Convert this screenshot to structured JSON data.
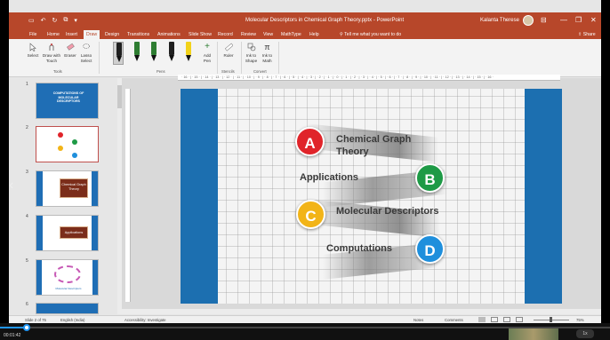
{
  "window": {
    "title": "Molecular Descriptors in Chemical Graph Theory.pptx - PowerPoint",
    "user": "Kalanta Therese",
    "qat": [
      "▭",
      "↶",
      "↻",
      "⧉",
      "▾"
    ],
    "controls": [
      "⊟",
      "—",
      "❐",
      "✕"
    ]
  },
  "tabs": {
    "items": [
      "File",
      "Home",
      "Insert",
      "Draw",
      "Design",
      "Transitions",
      "Animations",
      "Slide Show",
      "Record",
      "Review",
      "View",
      "MathType",
      "Help"
    ],
    "active": "Draw",
    "tell_me": "Tell me what you want to do",
    "share": "Share"
  },
  "ribbon": {
    "tools": [
      "Select",
      "Draw with Touch",
      "Eraser",
      "Lasso Select"
    ],
    "tools_group": "Tools",
    "pens_group": "Pens",
    "pens": [
      {
        "color": "#1f1f1f",
        "selected": true
      },
      {
        "color": "#2e7d32",
        "selected": false
      },
      {
        "color": "#2e7d32",
        "selected": false
      },
      {
        "color": "#1f1f1f",
        "selected": false
      },
      {
        "color": "#f2d21a",
        "selected": false
      }
    ],
    "add_pen": "Add Pen",
    "ruler": "Ruler",
    "stencils_group": "Stencils",
    "ink_to_shape": "Ink to Shape",
    "ink_to_math": "Ink to Math",
    "convert_group": "Convert"
  },
  "slides": {
    "numbers": [
      "1",
      "2",
      "3",
      "4",
      "5",
      "6"
    ],
    "selected": 2,
    "thumb1_title": "COMPUTATIONS OF MOLECULAR DESCRIPTORS",
    "thumb3_title": "Chemical Graph Theory",
    "thumb4_title": "Applications",
    "thumb5_title": "Molecular Descriptors"
  },
  "ruler_text": "· 16 · | · 15 · | · 14 · | · 13 · | · 12 · | · 11 · | · 10 · | · 9 · | · 8 · | · 7 · | · 6 · | · 5 · | · 4 · | · 3 · | · 2 · | · 1 · | · 0 · | · 1 · | · 2 · | · 3 · | · 4 · | · 5 · | · 6 · | · 7 · | · 8 · | · 9 · | · 10 · | · 11 · | · 12 · | · 13 · | · 14 · | · 15 · | · 16 ·",
  "slide": {
    "items": [
      {
        "letter": "A",
        "label": "Chemical Graph Theory",
        "color": "#e0242a"
      },
      {
        "letter": "B",
        "label": "Applications",
        "color": "#1e9a46"
      },
      {
        "letter": "C",
        "label": "Molecular Descriptors",
        "color": "#f2b417"
      },
      {
        "letter": "D",
        "label": "Computations",
        "color": "#1f8fdc"
      }
    ],
    "band_color": "#1c6fb0"
  },
  "status": {
    "slide": "Slide 2 of 75",
    "language": "English (India)",
    "accessibility": "Accessibility: Investigate",
    "notes": "Notes",
    "comments": "Comments",
    "zoom": "75%"
  },
  "player": {
    "time": "00:01:42",
    "speed": "1x"
  }
}
